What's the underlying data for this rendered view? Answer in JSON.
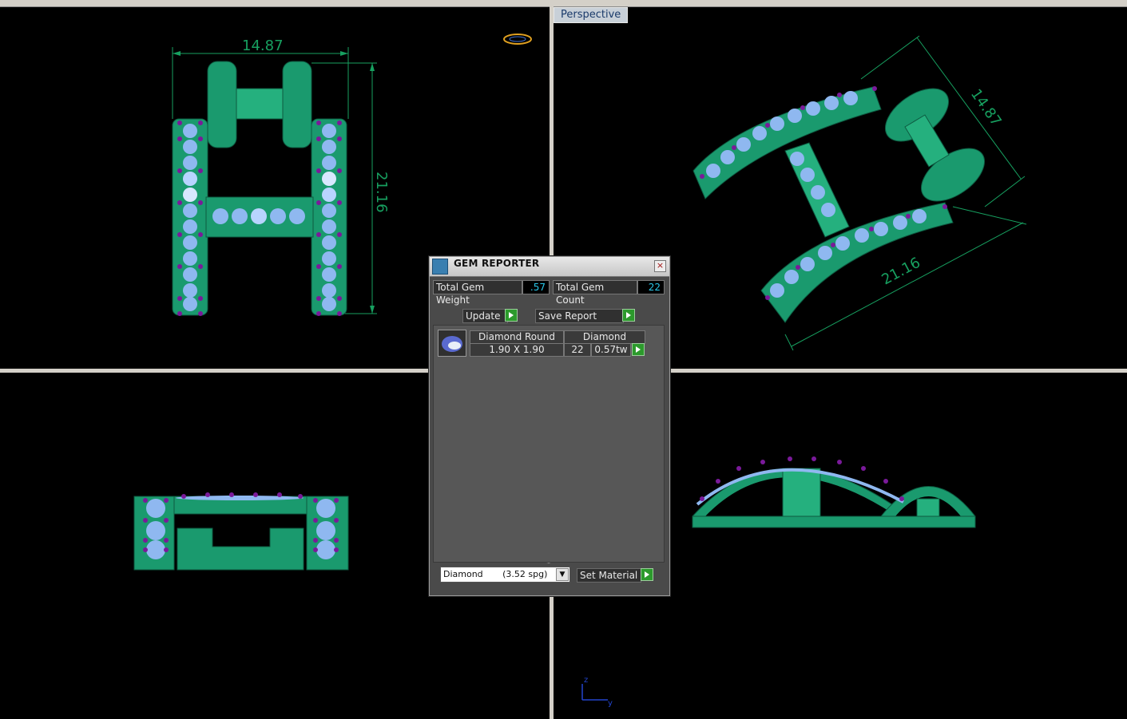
{
  "viewports": {
    "perspective_label": "Perspective"
  },
  "dimensions": {
    "top_width": "14.87",
    "top_height": "21.16",
    "persp_width": "14.87",
    "persp_length": "21.16"
  },
  "axis": {
    "z": "z",
    "y": "y"
  },
  "gem_reporter": {
    "title": "GEM REPORTER",
    "close_glyph": "×",
    "total_weight_label": "Total Gem Weight",
    "total_weight_value": ".57",
    "total_count_label": "Total Gem Count",
    "total_count_value": "22",
    "update_label": "Update",
    "save_report_label": "Save Report",
    "columns": {
      "shape": "Diamond Round",
      "material": "Diamond"
    },
    "row": {
      "size": "1.90 X 1.90",
      "count": "22",
      "weight": "0.57tw"
    },
    "material_select": "Diamond       (3.52 spg)",
    "set_material_label": "Set Material"
  },
  "colors": {
    "metal": "#1a9a6e",
    "dimension": "#17a060",
    "gem": "#8fb8f0",
    "prong": "#7a1a9a",
    "panel": "#4a4a4a"
  }
}
